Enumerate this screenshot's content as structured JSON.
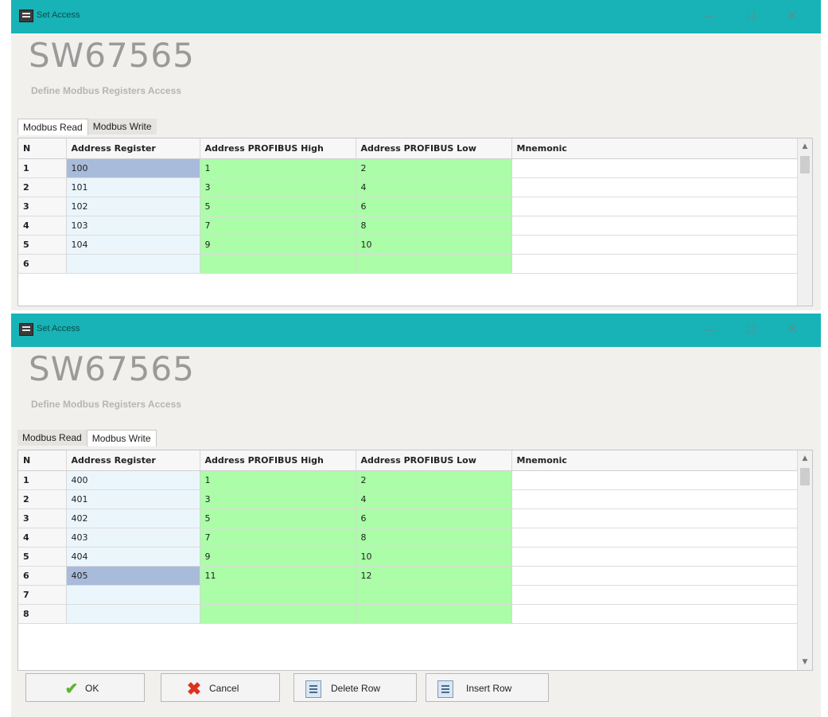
{
  "colors": {
    "titlebar": "#17b3b6",
    "address_register_bg": "#ebf6fc",
    "selected_cell_bg": "#a9bbdb",
    "profibus_bg": "#abfda8",
    "window_bg": "#f2f0ec"
  },
  "windows": [
    {
      "title": "Set Access",
      "brand": "SW67565",
      "subtitle": "Define Modbus Registers Access",
      "tabs": [
        {
          "label": "Modbus Read",
          "active": true
        },
        {
          "label": "Modbus Write",
          "active": false
        }
      ],
      "columns": [
        "N",
        "Address Register",
        "Address PROFIBUS High",
        "Address PROFIBUS Low",
        "Mnemonic"
      ],
      "rows": [
        {
          "n": "1",
          "address": "100",
          "high": "1",
          "low": "2",
          "mnemonic": ""
        },
        {
          "n": "2",
          "address": "101",
          "high": "3",
          "low": "4",
          "mnemonic": ""
        },
        {
          "n": "3",
          "address": "102",
          "high": "5",
          "low": "6",
          "mnemonic": ""
        },
        {
          "n": "4",
          "address": "103",
          "high": "7",
          "low": "8",
          "mnemonic": ""
        },
        {
          "n": "5",
          "address": "104",
          "high": "9",
          "low": "10",
          "mnemonic": ""
        },
        {
          "n": "6",
          "address": "",
          "high": "",
          "low": "",
          "mnemonic": ""
        }
      ]
    },
    {
      "title": "Set Access",
      "brand": "SW67565",
      "subtitle": "Define Modbus Registers Access",
      "tabs": [
        {
          "label": "Modbus Read",
          "active": false
        },
        {
          "label": "Modbus Write",
          "active": true
        }
      ],
      "columns": [
        "N",
        "Address Register",
        "Address PROFIBUS High",
        "Address PROFIBUS Low",
        "Mnemonic"
      ],
      "rows": [
        {
          "n": "1",
          "address": "400",
          "high": "1",
          "low": "2",
          "mnemonic": ""
        },
        {
          "n": "2",
          "address": "401",
          "high": "3",
          "low": "4",
          "mnemonic": ""
        },
        {
          "n": "3",
          "address": "402",
          "high": "5",
          "low": "6",
          "mnemonic": ""
        },
        {
          "n": "4",
          "address": "403",
          "high": "7",
          "low": "8",
          "mnemonic": ""
        },
        {
          "n": "5",
          "address": "404",
          "high": "9",
          "low": "10",
          "mnemonic": ""
        },
        {
          "n": "6",
          "address": "405",
          "high": "11",
          "low": "12",
          "mnemonic": ""
        },
        {
          "n": "7",
          "address": "",
          "high": "",
          "low": "",
          "mnemonic": ""
        },
        {
          "n": "8",
          "address": "",
          "high": "",
          "low": "",
          "mnemonic": ""
        }
      ],
      "buttons": {
        "ok": "OK",
        "cancel": "Cancel",
        "delete_row": "Delete Row",
        "insert_row": "Insert Row"
      }
    }
  ]
}
